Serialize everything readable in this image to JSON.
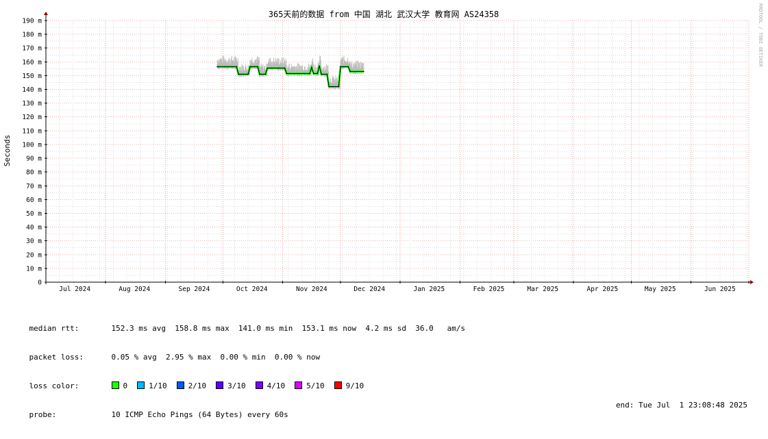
{
  "title": "365天前的数据 from 中国 湖北 武汉大学 教育网 AS24358",
  "watermark": "RRDTOOL / TOBI OETIKER",
  "chart_data": {
    "type": "line",
    "title": "365天前的数据 from 中国 湖北 武汉大学 教育网 AS24358",
    "ylabel": "Seconds",
    "xlabel": "",
    "y_unit_suffix": "m",
    "ylim": [
      0,
      190
    ],
    "y_ticks": [
      {
        "v": 190,
        "label": "190 m"
      },
      {
        "v": 180,
        "label": "180 m"
      },
      {
        "v": 170,
        "label": "170 m"
      },
      {
        "v": 160,
        "label": "160 m"
      },
      {
        "v": 150,
        "label": "150 m"
      },
      {
        "v": 140,
        "label": "140 m"
      },
      {
        "v": 130,
        "label": "130 m"
      },
      {
        "v": 120,
        "label": "120 m"
      },
      {
        "v": 110,
        "label": "110 m"
      },
      {
        "v": 100,
        "label": "100 m"
      },
      {
        "v": 90,
        "label": "90 m"
      },
      {
        "v": 80,
        "label": "80 m"
      },
      {
        "v": 70,
        "label": "70 m"
      },
      {
        "v": 60,
        "label": "60 m"
      },
      {
        "v": 50,
        "label": "50 m"
      },
      {
        "v": 40,
        "label": "40 m"
      },
      {
        "v": 30,
        "label": "30 m"
      },
      {
        "v": 20,
        "label": "20 m"
      },
      {
        "v": 10,
        "label": "10 m"
      },
      {
        "v": 0,
        "label": "0"
      }
    ],
    "x_range": [
      "2024-07-01",
      "2025-07-01"
    ],
    "x_tick_labels": [
      {
        "date": "2024-07-16",
        "label": "Jul 2024"
      },
      {
        "date": "2024-08-16",
        "label": "Aug 2024"
      },
      {
        "date": "2024-09-16",
        "label": "Sep 2024"
      },
      {
        "date": "2024-10-16",
        "label": "Oct 2024"
      },
      {
        "date": "2024-11-16",
        "label": "Nov 2024"
      },
      {
        "date": "2024-12-16",
        "label": "Dec 2024"
      },
      {
        "date": "2025-01-16",
        "label": "Jan 2025"
      },
      {
        "date": "2025-02-16",
        "label": "Feb 2025"
      },
      {
        "date": "2025-03-16",
        "label": "Mar 2025"
      },
      {
        "date": "2025-04-16",
        "label": "Apr 2025"
      },
      {
        "date": "2025-05-16",
        "label": "May 2025"
      },
      {
        "date": "2025-06-16",
        "label": "Jun 2025"
      }
    ],
    "grid": true,
    "colors": {
      "grid_minor": "#dddddd",
      "grid_major": "#ee9999",
      "smoke": "#bbbbbb",
      "median": "#000000",
      "loss_0": "#26ff00",
      "loss_1": "#00b8ff",
      "loss_2": "#0059ff",
      "loss_3": "#5e00ff",
      "loss_4": "#7e00ff",
      "loss_5": "#dd00ff",
      "loss_9": "#ff0000",
      "axis_arrow": "#880000"
    },
    "median_series": {
      "name": "median rtt",
      "points": [
        {
          "x": "2024-09-28",
          "y": 156.5
        },
        {
          "x": "2024-10-08",
          "y": 156.5
        },
        {
          "x": "2024-10-09",
          "y": 151.0
        },
        {
          "x": "2024-10-14",
          "y": 151.0
        },
        {
          "x": "2024-10-15",
          "y": 156.5
        },
        {
          "x": "2024-10-19",
          "y": 156.5
        },
        {
          "x": "2024-10-20",
          "y": 151.0
        },
        {
          "x": "2024-10-23",
          "y": 151.0
        },
        {
          "x": "2024-10-24",
          "y": 155.5
        },
        {
          "x": "2024-11-02",
          "y": 155.5
        },
        {
          "x": "2024-11-03",
          "y": 151.5
        },
        {
          "x": "2024-11-15",
          "y": 151.5
        },
        {
          "x": "2024-11-16",
          "y": 156.0
        },
        {
          "x": "2024-11-17",
          "y": 151.5
        },
        {
          "x": "2024-11-19",
          "y": 151.5
        },
        {
          "x": "2024-11-20",
          "y": 157.0
        },
        {
          "x": "2024-11-21",
          "y": 151.0
        },
        {
          "x": "2024-11-24",
          "y": 151.0
        },
        {
          "x": "2024-11-25",
          "y": 142.0
        },
        {
          "x": "2024-11-30",
          "y": 142.0
        },
        {
          "x": "2024-12-01",
          "y": 156.5
        },
        {
          "x": "2024-12-05",
          "y": 156.5
        },
        {
          "x": "2024-12-06",
          "y": 153.0
        },
        {
          "x": "2024-12-13",
          "y": 153.0
        }
      ]
    },
    "smoke_upper_offset_ms": 6
  },
  "stats": {
    "median_rtt": {
      "label": "median rtt:",
      "text": "152.3 ms avg  158.8 ms max  141.0 ms min  153.1 ms now  4.2 ms sd  36.0   am/s"
    },
    "packet_loss": {
      "label": "packet loss:",
      "text": "0.05 % avg  2.95 % max  0.00 % min  0.00 % now"
    },
    "loss_color": {
      "label": "loss color:",
      "items": [
        {
          "label": "0",
          "color": "#26ff00"
        },
        {
          "label": "1/10",
          "color": "#00b8ff"
        },
        {
          "label": "2/10",
          "color": "#0059ff"
        },
        {
          "label": "3/10",
          "color": "#5e00ff"
        },
        {
          "label": "4/10",
          "color": "#7e00ff"
        },
        {
          "label": "5/10",
          "color": "#dd00ff"
        },
        {
          "label": "9/10",
          "color": "#ff0000"
        }
      ]
    },
    "probe": {
      "label": "probe:",
      "text": "10 ICMP Echo Pings (64 Bytes) every 60s"
    },
    "end": "end: Tue Jul  1 23:08:48 2025"
  }
}
